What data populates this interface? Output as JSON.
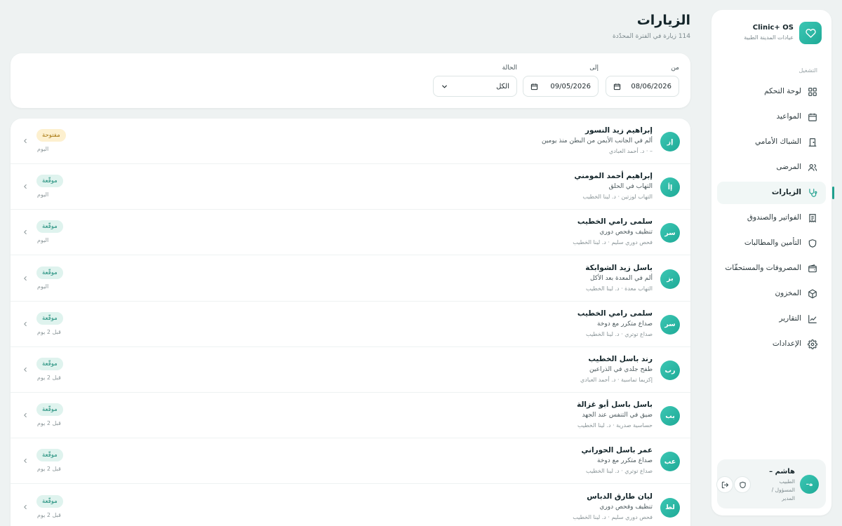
{
  "app": {
    "name": "Clinic+ OS",
    "subtitle": "عيادات المدينة الطبية"
  },
  "sidebar": {
    "section_label": "التشغيل",
    "items": [
      {
        "label": "لوحة التحكم",
        "icon": "grid-icon"
      },
      {
        "label": "المواعيد",
        "icon": "calendar-icon"
      },
      {
        "label": "الشباك الأمامي",
        "icon": "door-icon"
      },
      {
        "label": "المرضى",
        "icon": "users-icon"
      },
      {
        "label": "الزيارات",
        "icon": "stethoscope-icon",
        "active": true
      },
      {
        "label": "الفواتير والصندوق",
        "icon": "receipt-icon"
      },
      {
        "label": "التأمين والمطالبات",
        "icon": "shield-icon"
      },
      {
        "label": "المصروفات والمستحقّات",
        "icon": "wallet-icon"
      },
      {
        "label": "المخزون",
        "icon": "box-icon"
      },
      {
        "label": "التقارير",
        "icon": "chart-icon"
      },
      {
        "label": "الإعدادات",
        "icon": "gear-icon"
      }
    ],
    "user": {
      "initials": "ه–",
      "name": "هاشم –",
      "role": "الطبيب المسؤول / المدير"
    }
  },
  "page": {
    "title": "الزيارات",
    "subtitle": "114 زيارة في الفترة المحدّدة"
  },
  "filters": {
    "from_label": "من",
    "from_value": "08/06/2026",
    "to_label": "إلى",
    "to_value": "09/05/2026",
    "status_label": "الحالة",
    "status_value": "الكل"
  },
  "visits": [
    {
      "initials": "إز",
      "name": "إبراهيم زيد النسور",
      "complaint": "ألم في الجانب الأيمن من البطن منذ يومين",
      "meta": "– · د. أحمد العبادي",
      "status": "مفتوحة",
      "status_type": "open",
      "date": "اليوم"
    },
    {
      "initials": "إأ",
      "name": "إبراهيم أحمد المومني",
      "complaint": "التهاب في الحلق",
      "meta": "التهاب لوزتين · د. لينا الخطيب",
      "status": "موقّعة",
      "status_type": "signed",
      "date": "اليوم"
    },
    {
      "initials": "سر",
      "name": "سلمى رامي الخطيب",
      "complaint": "تنظيف وفحص دوري",
      "meta": "فحص دوري سليم · د. لينا الخطيب",
      "status": "موقّعة",
      "status_type": "signed",
      "date": "اليوم"
    },
    {
      "initials": "بز",
      "name": "باسل زيد الشوابكة",
      "complaint": "ألم في المعدة بعد الأكل",
      "meta": "التهاب معدة · د. لينا الخطيب",
      "status": "موقّعة",
      "status_type": "signed",
      "date": "اليوم"
    },
    {
      "initials": "سر",
      "name": "سلمى رامي الخطيب",
      "complaint": "صداع متكرر مع دوخة",
      "meta": "صداع توتري · د. لينا الخطيب",
      "status": "موقّعة",
      "status_type": "signed",
      "date": "قبل 2 يوم"
    },
    {
      "initials": "رب",
      "name": "رند باسل الخطيب",
      "complaint": "طفح جلدي في الذراعين",
      "meta": "إكزيما تماسية · د. أحمد العبادي",
      "status": "موقّعة",
      "status_type": "signed",
      "date": "قبل 2 يوم"
    },
    {
      "initials": "بب",
      "name": "باسل باسل أبو غزالة",
      "complaint": "ضيق في التنفس عند الجهد",
      "meta": "حساسية صدرية · د. لينا الخطيب",
      "status": "موقّعة",
      "status_type": "signed",
      "date": "قبل 2 يوم"
    },
    {
      "initials": "عب",
      "name": "عمر باسل الحوراني",
      "complaint": "صداع متكرر مع دوخة",
      "meta": "صداع توتري · د. لينا الخطيب",
      "status": "موقّعة",
      "status_type": "signed",
      "date": "قبل 2 يوم"
    },
    {
      "initials": "لط",
      "name": "ليان طارق الدباس",
      "complaint": "تنظيف وفحص دوري",
      "meta": "فحص دوري سليم · د. لينا الخطيب",
      "status": "موقّعة",
      "status_type": "signed",
      "date": "قبل 2 يوم"
    }
  ],
  "colors": {
    "accent": "#1fa08e",
    "badge_open_bg": "#fdf0cf",
    "badge_open_text": "#a6750c",
    "badge_signed_bg": "#dff3ee",
    "badge_signed_text": "#1a8b78"
  }
}
